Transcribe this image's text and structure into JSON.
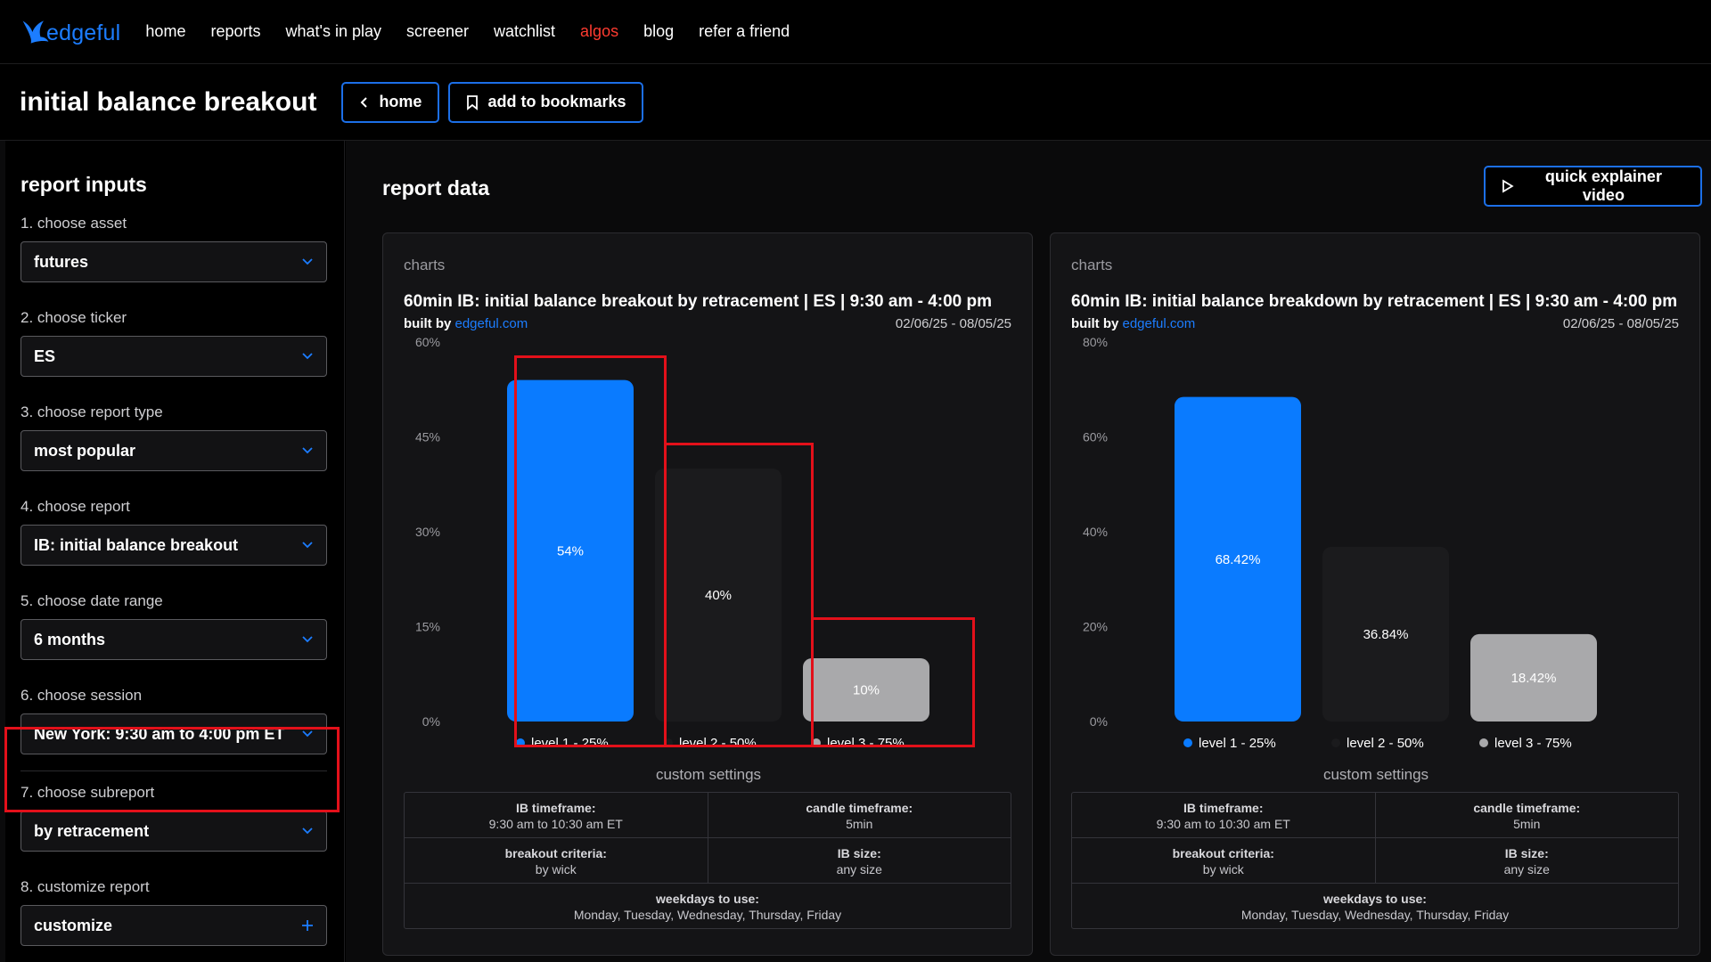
{
  "nav": {
    "logo_text": "edgeful",
    "links": [
      "home",
      "reports",
      "what's in play",
      "screener",
      "watchlist",
      "algos",
      "blog",
      "refer a friend"
    ],
    "active": "algos"
  },
  "header": {
    "title": "initial balance breakout",
    "home_label": "home",
    "bookmark_label": "add to bookmarks"
  },
  "sidebar": {
    "title": "report inputs",
    "fields": [
      {
        "label": "1. choose asset",
        "value": "futures"
      },
      {
        "label": "2. choose ticker",
        "value": "ES"
      },
      {
        "label": "3. choose report type",
        "value": "most popular"
      },
      {
        "label": "4. choose report",
        "value": "IB: initial balance breakout"
      },
      {
        "label": "5. choose date range",
        "value": "6 months"
      },
      {
        "label": "6. choose session",
        "value": "New York: 9:30 am to 4:00 pm ET"
      },
      {
        "label": "7. choose subreport",
        "value": "by retracement"
      },
      {
        "label": "8. customize report",
        "value": "customize"
      }
    ]
  },
  "main": {
    "title": "report data",
    "explainer_label": "quick explainer video"
  },
  "colors": {
    "blue": "#0a7bff",
    "dark": "#1b1b1d",
    "gray": "#a9a9ab",
    "annotation": "#e3101a"
  },
  "cards": [
    {
      "kicker": "charts",
      "title": "60min IB: initial balance breakout by retracement | ES | 9:30 am - 4:00 pm",
      "built_by": "built by",
      "built_link": "edgeful.com",
      "date_range": "02/06/25 - 08/05/25",
      "custom_title": "custom settings",
      "settings": {
        "ib_timeframe_k": "IB timeframe:",
        "ib_timeframe_v": "9:30 am to 10:30 am ET",
        "candle_k": "candle timeframe:",
        "candle_v": "5min",
        "criteria_k": "breakout criteria:",
        "criteria_v": "by wick",
        "size_k": "IB size:",
        "size_v": "any size",
        "weekdays_k": "weekdays to use:",
        "weekdays_v": "Monday, Tuesday, Wednesday, Thursday, Friday"
      }
    },
    {
      "kicker": "charts",
      "title": "60min IB: initial balance breakdown by retracement | ES | 9:30 am - 4:00 pm",
      "built_by": "built by",
      "built_link": "edgeful.com",
      "date_range": "02/06/25 - 08/05/25",
      "custom_title": "custom settings",
      "settings": {
        "ib_timeframe_k": "IB timeframe:",
        "ib_timeframe_v": "9:30 am to 10:30 am ET",
        "candle_k": "candle timeframe:",
        "candle_v": "5min",
        "criteria_k": "breakout criteria:",
        "criteria_v": "by wick",
        "size_k": "IB size:",
        "size_v": "any size",
        "weekdays_k": "weekdays to use:",
        "weekdays_v": "Monday, Tuesday, Wednesday, Thursday, Friday"
      }
    }
  ],
  "chart_data": [
    {
      "type": "bar",
      "categories": [
        "level 1 - 25%",
        "level 2 - 50%",
        "level 3 - 75%"
      ],
      "values": [
        54,
        40,
        10
      ],
      "labels": [
        "54%",
        "40%",
        "10%"
      ],
      "ylim": [
        0,
        60
      ],
      "yticks": [
        0,
        15,
        30,
        45,
        60
      ],
      "yticklabels": [
        "0%",
        "15%",
        "30%",
        "45%",
        "60%"
      ],
      "colors": [
        "#0a7bff",
        "#1b1b1d",
        "#a9a9ab"
      ],
      "legend": "bottom",
      "grid": false
    },
    {
      "type": "bar",
      "categories": [
        "level 1 - 25%",
        "level 2 - 50%",
        "level 3 - 75%"
      ],
      "values": [
        68.42,
        36.84,
        18.42
      ],
      "labels": [
        "68.42%",
        "36.84%",
        "18.42%"
      ],
      "ylim": [
        0,
        80
      ],
      "yticks": [
        0,
        20,
        40,
        60,
        80
      ],
      "yticklabels": [
        "0%",
        "20%",
        "40%",
        "60%",
        "80%"
      ],
      "colors": [
        "#0a7bff",
        "#1b1b1d",
        "#a9a9ab"
      ],
      "legend": "bottom",
      "grid": false
    }
  ]
}
